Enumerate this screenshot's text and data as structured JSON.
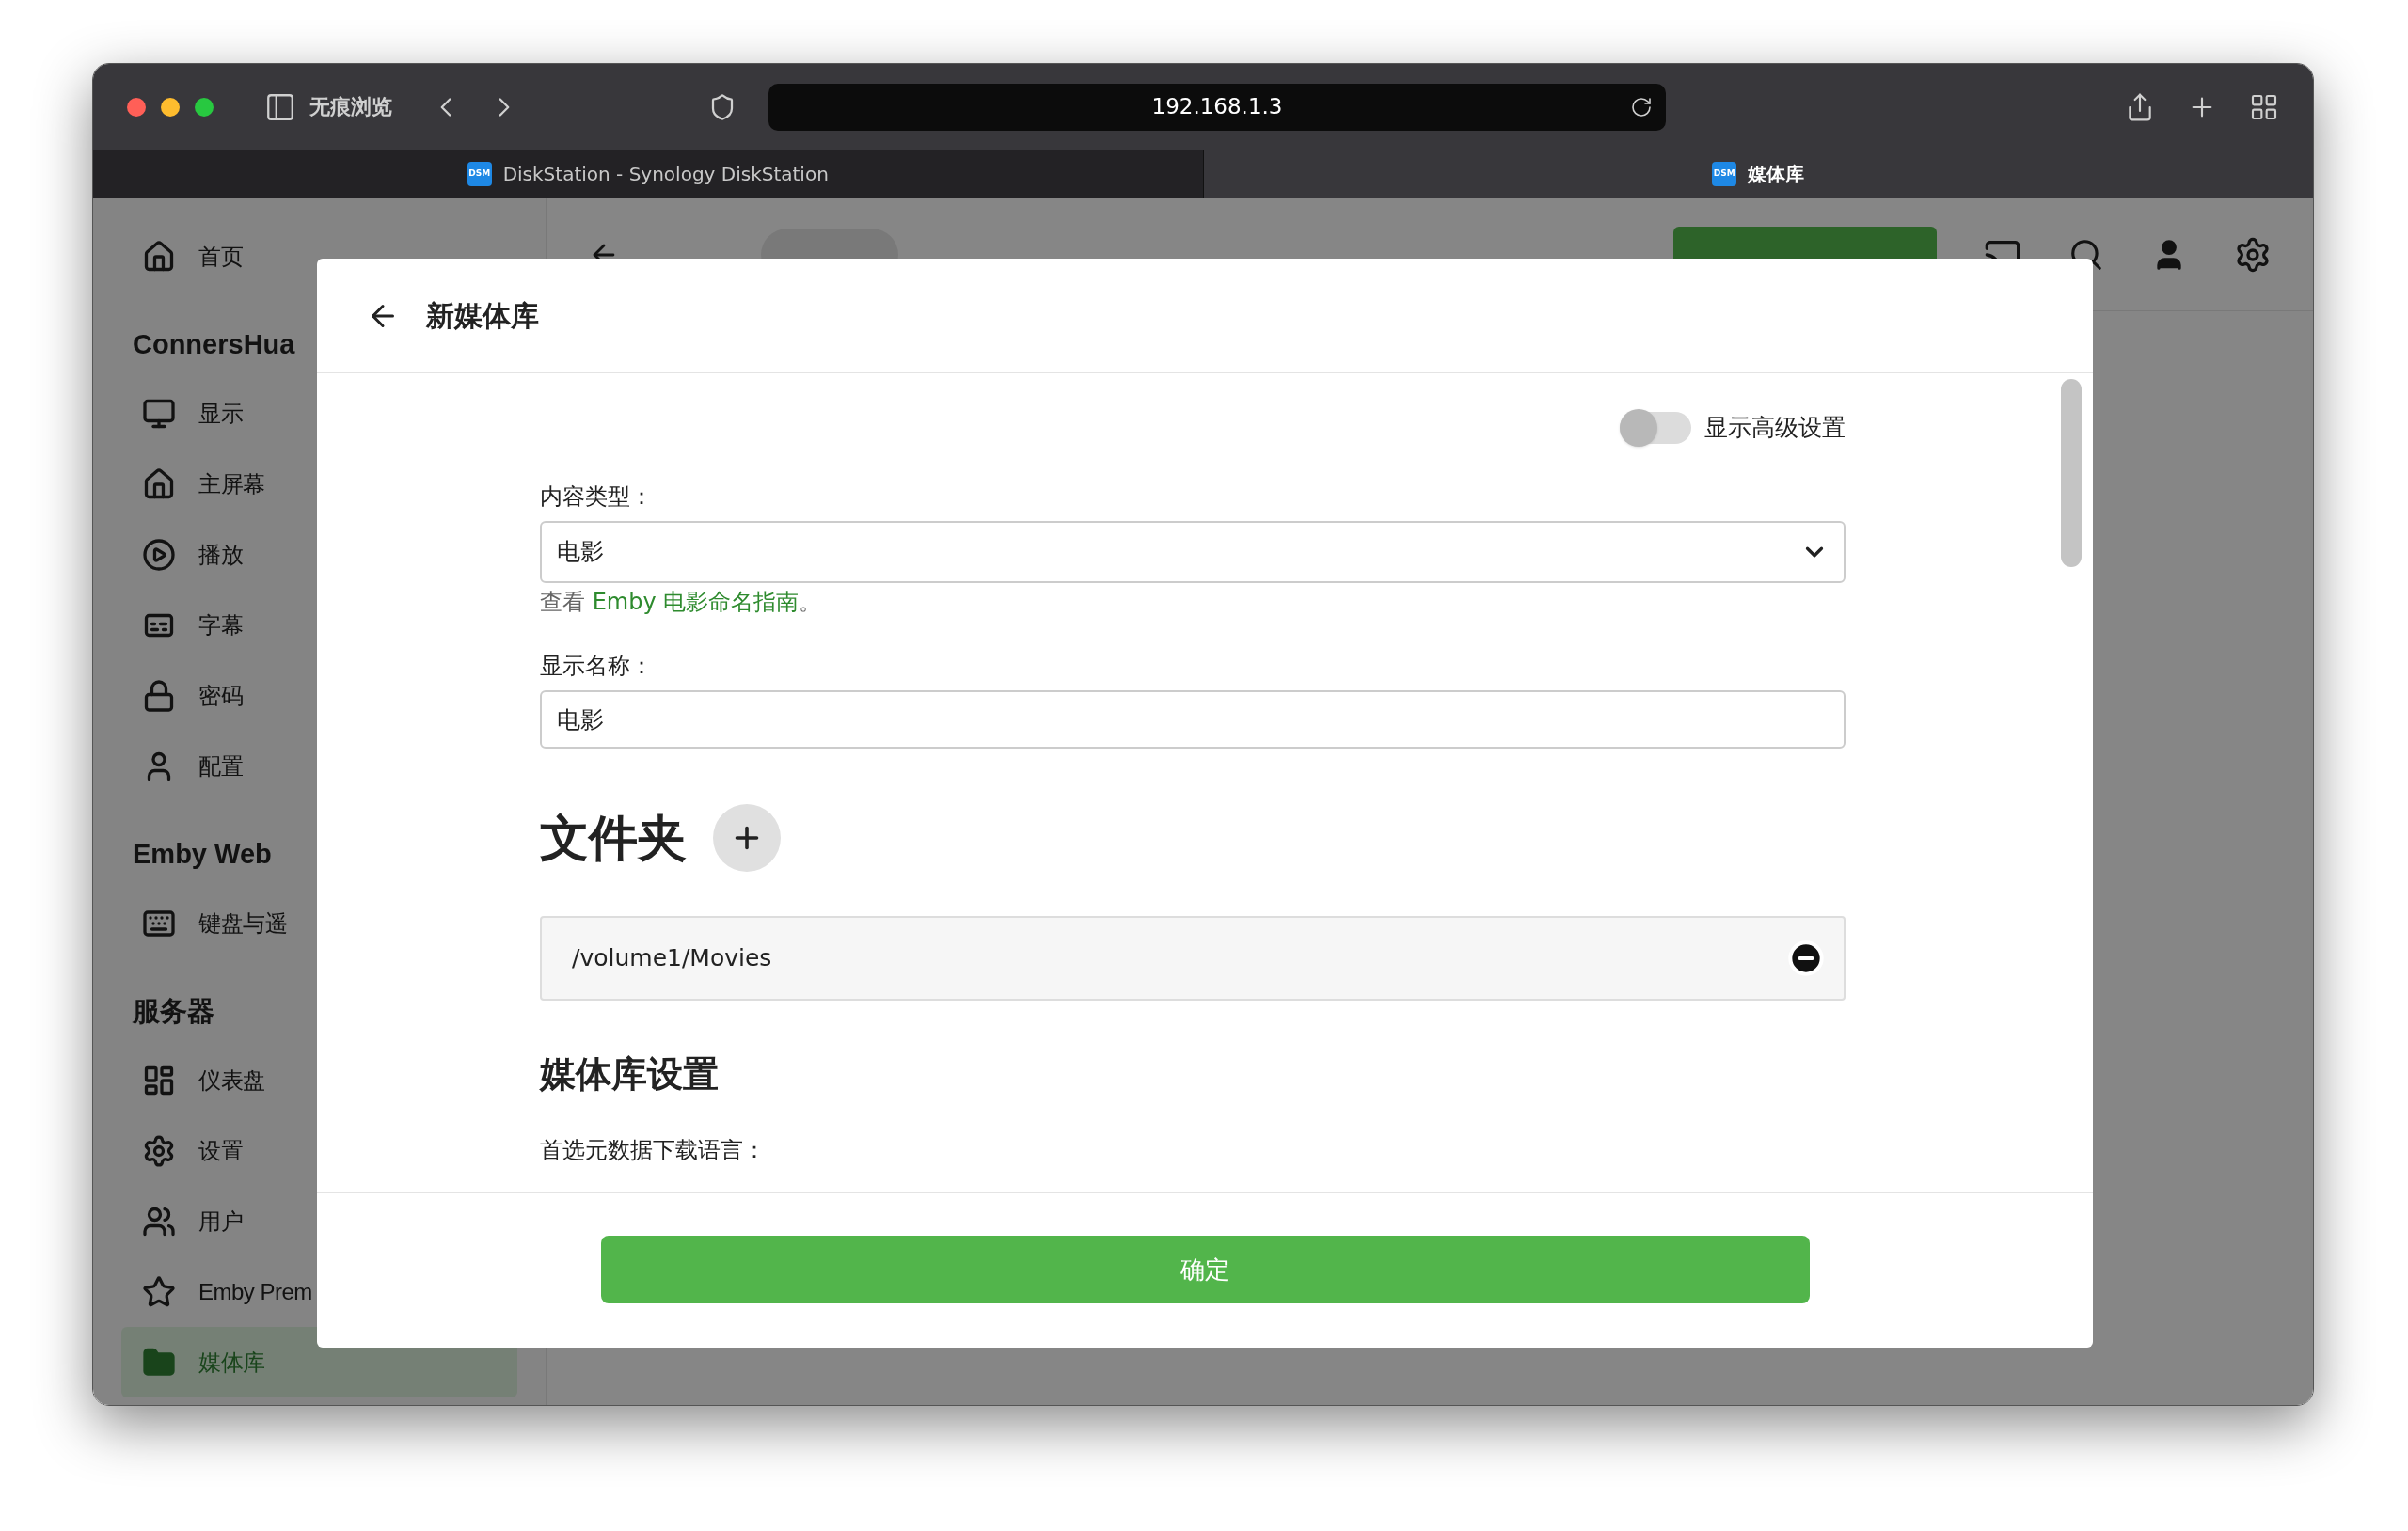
{
  "browser": {
    "private_label": "无痕浏览",
    "address": "192.168.1.3",
    "tabs": [
      {
        "label": "DiskStation - Synology DiskStation",
        "favicon": "DSM",
        "selected": false
      },
      {
        "label": "媒体库",
        "favicon": "DSM",
        "selected": true
      }
    ]
  },
  "sidebar": {
    "sections": [
      {
        "items": [
          {
            "label": "首页",
            "selected": false
          }
        ]
      },
      {
        "title": "ConnersHua",
        "items": [
          {
            "label": "显示",
            "selected": false
          },
          {
            "label": "主屏幕",
            "selected": false
          },
          {
            "label": "播放",
            "selected": false
          },
          {
            "label": "字幕",
            "selected": false
          },
          {
            "label": "密码",
            "selected": false
          },
          {
            "label": "配置",
            "selected": false
          }
        ]
      },
      {
        "title": "Emby Web",
        "items": [
          {
            "label": "键盘与遥",
            "selected": false
          }
        ]
      },
      {
        "title": "服务器",
        "items": [
          {
            "label": "仪表盘",
            "selected": false
          },
          {
            "label": "设置",
            "selected": false
          },
          {
            "label": "用户",
            "selected": false
          },
          {
            "label": "Emby Prem",
            "selected": false
          },
          {
            "label": "媒体库",
            "selected": true
          }
        ]
      }
    ]
  },
  "dialog": {
    "title": "新媒体库",
    "advanced_toggle": {
      "label": "显示高级设置",
      "on": false
    },
    "content_type": {
      "label": "内容类型：",
      "value": "电影"
    },
    "hint": {
      "prefix": "查看 ",
      "link": "Emby 电影命名指南",
      "suffix": "。"
    },
    "display_name": {
      "label": "显示名称：",
      "value": "电影"
    },
    "folders": {
      "title": "文件夹",
      "items": [
        "/volume1/Movies"
      ]
    },
    "library_settings": {
      "title": "媒体库设置",
      "metadata_language_label": "首选元数据下载语言："
    },
    "confirm": "确定"
  }
}
